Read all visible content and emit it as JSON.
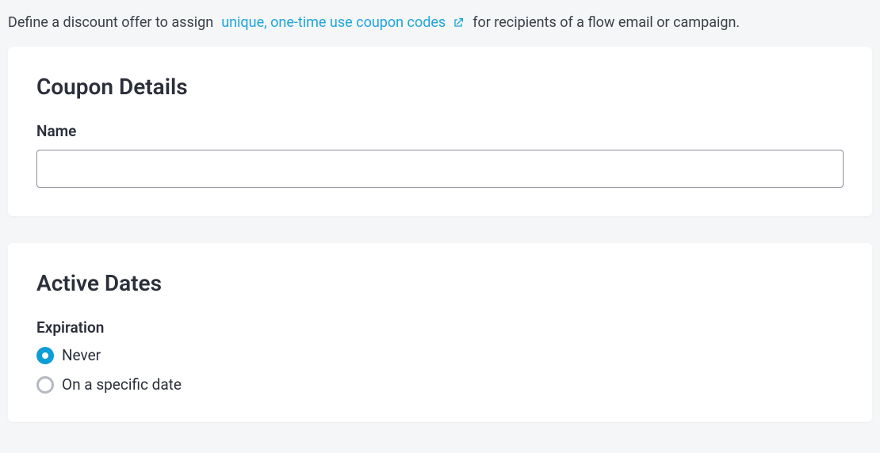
{
  "intro": {
    "prefix": "Define a discount offer to assign",
    "link_text": "unique, one-time use coupon codes",
    "suffix": "for recipients of a flow email or campaign."
  },
  "coupon_details": {
    "heading": "Coupon Details",
    "name_label": "Name",
    "name_value": ""
  },
  "active_dates": {
    "heading": "Active Dates",
    "expiration_label": "Expiration",
    "options": [
      {
        "label": "Never",
        "selected": true
      },
      {
        "label": "On a specific date",
        "selected": false
      }
    ]
  }
}
